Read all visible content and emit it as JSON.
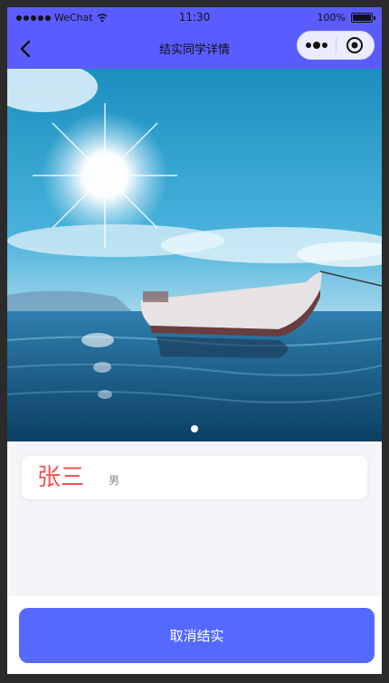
{
  "status_bar": {
    "carrier": "WeChat",
    "time": "11:30",
    "battery": "100%"
  },
  "nav": {
    "title": "结实同学详情",
    "icons": [
      "back-icon",
      "more-icon",
      "close-icon"
    ]
  },
  "banner": {
    "image_description": "boat-on-sea",
    "indicator_count": 1,
    "active_index": 0
  },
  "student": {
    "name": "张三",
    "gender": "男"
  },
  "footer": {
    "button_label": "取消结实"
  },
  "colors": {
    "nav_bg": "#5a5cff",
    "name_color": "#f0524f",
    "button_bg": "#5469ff",
    "page_bg": "#f4f5f9"
  }
}
